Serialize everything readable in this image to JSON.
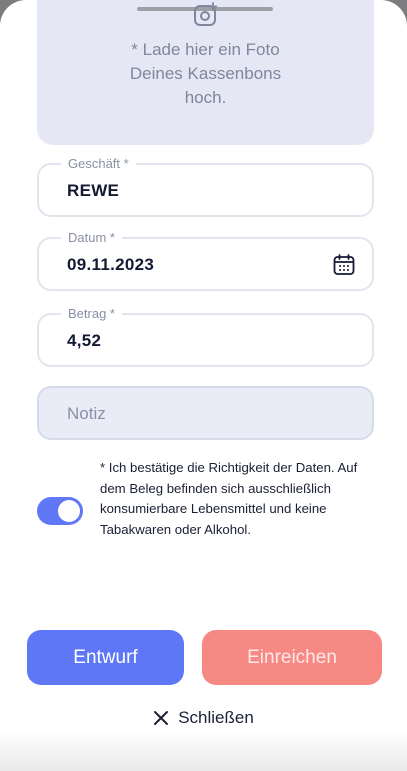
{
  "upload": {
    "hint": "* Lade hier ein Foto\nDeines Kassenbons\nhoch.",
    "icon": "camera-plus-icon"
  },
  "form": {
    "store": {
      "label": "Geschäft *",
      "value": "REWE"
    },
    "date": {
      "label": "Datum *",
      "value": "09.11.2023",
      "icon": "calendar-icon"
    },
    "amount": {
      "label": "Betrag *",
      "value": "4,52"
    },
    "note": {
      "placeholder": "Notiz"
    }
  },
  "consent": {
    "text": "* Ich bestätige die Richtigkeit der Daten. Auf dem Beleg befinden sich ausschließlich konsumierbare Lebensmittel und keine Tabakwaren oder Alkohol.",
    "checked": true
  },
  "actions": {
    "draft_label": "Entwurf",
    "submit_label": "Einreichen",
    "close_label": "Schließen"
  },
  "colors": {
    "primary": "#5e77f6",
    "submit": "#f78985",
    "upload_bg": "#e5e8f4"
  }
}
